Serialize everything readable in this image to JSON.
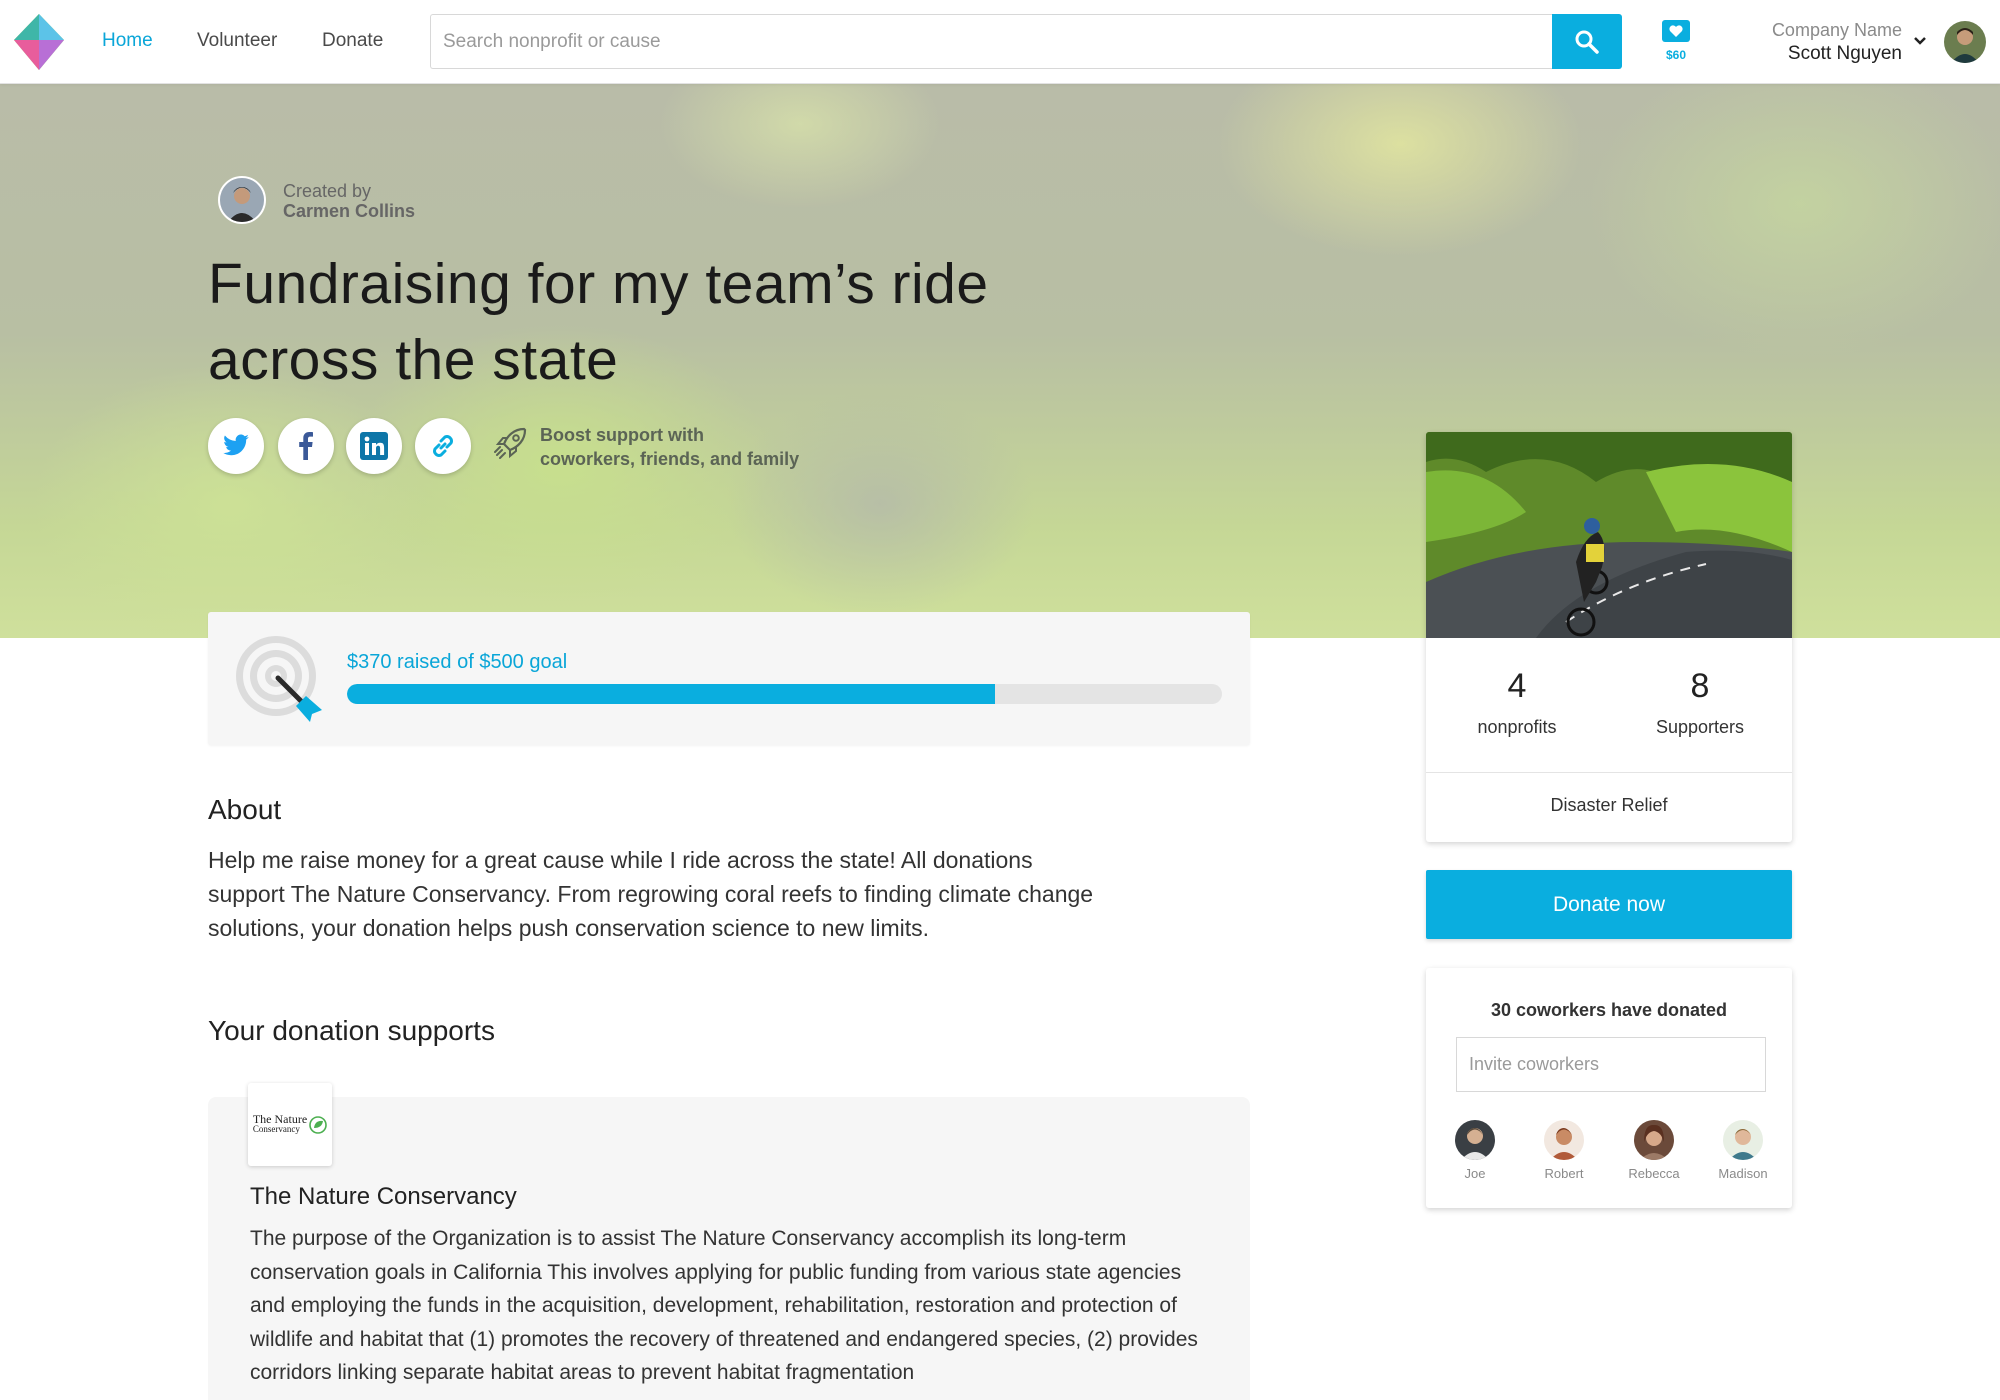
{
  "nav": {
    "links": [
      "Home",
      "Volunteer",
      "Donate"
    ],
    "active": "Home",
    "search_placeholder": "Search nonprofit or cause",
    "wallet_amount": "$60",
    "company_name": "Company Name",
    "user_name": "Scott Nguyen"
  },
  "hero": {
    "created_label": "Created by",
    "creator_name": "Carmen Collins",
    "title": "Fundraising for my team’s ride across the state",
    "boost_text_line1": "Boost support with",
    "boost_text_line2": "coworkers, friends, and family",
    "share_icons": [
      "twitter-icon",
      "facebook-icon",
      "linkedin-icon",
      "link-icon"
    ]
  },
  "goal": {
    "text": "$370 raised of $500 goal",
    "raised": 370,
    "target": 500,
    "progress_fraction": 0.74
  },
  "about": {
    "heading": "About",
    "body": "Help me raise money for a great cause while I ride across the state! All donations support The Nature Conservancy. From regrowing coral reefs to finding climate change solutions, your donation helps push conservation science to new limits."
  },
  "supports": {
    "heading": "Your donation supports",
    "logo_text_line1": "The Nature",
    "logo_text_line2": "Conservancy",
    "name": "The Nature Conservancy",
    "description": "The purpose of the Organization is to assist The Nature Conservancy accomplish its long-term conservation goals in California This involves applying for public funding from various state agencies and employing the funds in the acquisition, development, rehabilitation, restoration and protection of wildlife and habitat that (1) promotes the recovery of threatened and endangered species, (2) provides corridors linking separate habitat areas to prevent habitat fragmentation"
  },
  "sidebar": {
    "stats": [
      {
        "value": "4",
        "label": "nonprofits"
      },
      {
        "value": "8",
        "label": "Supporters"
      }
    ],
    "cause": "Disaster Relief",
    "donate_label": "Donate now",
    "coworkers_title": "30 coworkers have donated",
    "invite_placeholder": "Invite coworkers",
    "coworkers": [
      "Joe",
      "Robert",
      "Rebecca",
      "Madison"
    ]
  },
  "colors": {
    "accent": "#0aaedf",
    "progress_track": "#e4e4e4",
    "card_bg": "#f6f6f6"
  }
}
